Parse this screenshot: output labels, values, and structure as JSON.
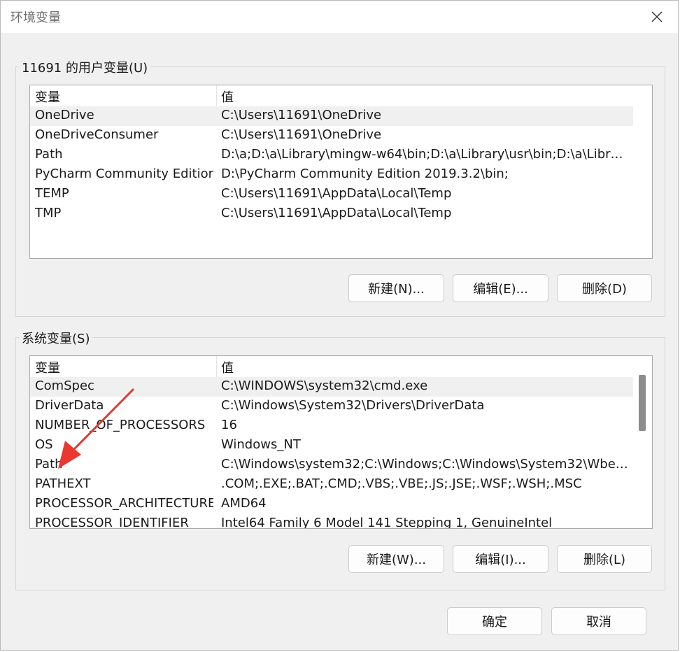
{
  "window": {
    "title": "环境变量",
    "close_icon": "close-icon"
  },
  "user_vars": {
    "group_title": "11691 的用户变量(U)",
    "headers": {
      "name": "变量",
      "value": "值"
    },
    "rows": [
      {
        "name": "OneDrive",
        "value": "C:\\Users\\11691\\OneDrive",
        "selected": true
      },
      {
        "name": "OneDriveConsumer",
        "value": "C:\\Users\\11691\\OneDrive"
      },
      {
        "name": "Path",
        "value": "D:\\a;D:\\a\\Library\\mingw-w64\\bin;D:\\a\\Library\\usr\\bin;D:\\a\\Library..."
      },
      {
        "name": "PyCharm Community Edition",
        "value": "D:\\PyCharm Community Edition 2019.3.2\\bin;"
      },
      {
        "name": "TEMP",
        "value": "C:\\Users\\11691\\AppData\\Local\\Temp"
      },
      {
        "name": "TMP",
        "value": "C:\\Users\\11691\\AppData\\Local\\Temp"
      }
    ],
    "buttons": {
      "new": "新建(N)...",
      "edit": "编辑(E)...",
      "delete": "删除(D)"
    }
  },
  "system_vars": {
    "group_title": "系统变量(S)",
    "headers": {
      "name": "变量",
      "value": "值"
    },
    "rows": [
      {
        "name": "ComSpec",
        "value": "C:\\WINDOWS\\system32\\cmd.exe",
        "selected": true
      },
      {
        "name": "DriverData",
        "value": "C:\\Windows\\System32\\Drivers\\DriverData"
      },
      {
        "name": "NUMBER_OF_PROCESSORS",
        "value": "16"
      },
      {
        "name": "OS",
        "value": "Windows_NT"
      },
      {
        "name": "Path",
        "value": "C:\\Windows\\system32;C:\\Windows;C:\\Windows\\System32\\Wbem;..."
      },
      {
        "name": "PATHEXT",
        "value": ".COM;.EXE;.BAT;.CMD;.VBS;.VBE;.JS;.JSE;.WSF;.WSH;.MSC"
      },
      {
        "name": "PROCESSOR_ARCHITECTURE",
        "value": "AMD64"
      },
      {
        "name": "PROCESSOR_IDENTIFIER",
        "value": "Intel64 Family 6 Model 141 Stepping 1, GenuineIntel"
      }
    ],
    "buttons": {
      "new": "新建(W)...",
      "edit": "编辑(I)...",
      "delete": "删除(L)"
    }
  },
  "footer": {
    "ok": "确定",
    "cancel": "取消"
  },
  "colors": {
    "annotation_arrow": "#e8382f",
    "selected_row": "#f0f0f0"
  }
}
